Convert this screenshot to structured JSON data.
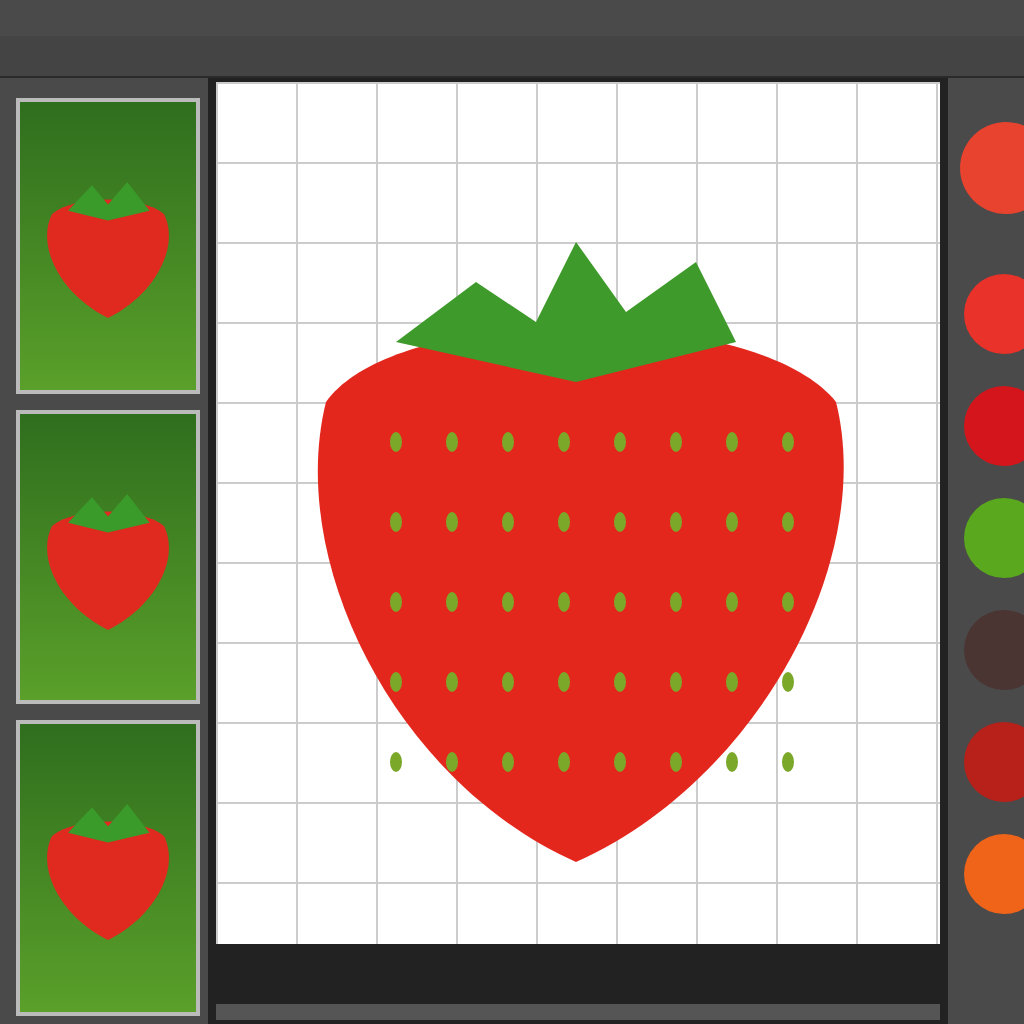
{
  "preview": {
    "color": "#e8432e"
  },
  "swatches": [
    {
      "color": "#e8322a"
    },
    {
      "color": "#d4161c"
    },
    {
      "color": "#5aa81e"
    },
    {
      "color": "#4a3533"
    },
    {
      "color": "#b8201a"
    },
    {
      "color": "#f0641a"
    }
  ]
}
